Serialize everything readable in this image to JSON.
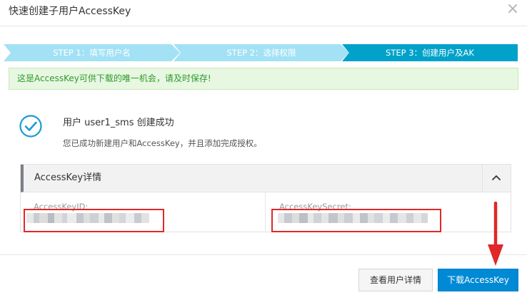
{
  "dialog": {
    "title": "快速创建子用户AccessKey",
    "close_glyph": "×"
  },
  "steps": [
    {
      "label": "STEP 1：填写用户名",
      "state": "done"
    },
    {
      "label": "STEP 2：选择权限",
      "state": "done"
    },
    {
      "label": "STEP 3：创建用户及AK",
      "state": "active"
    }
  ],
  "alert": {
    "text": "这是AccessKey可供下载的唯一机会，请及时保存!"
  },
  "result": {
    "icon": "check-circle-icon",
    "title": "用户 user1_sms 创建成功",
    "description": "您已成功新建用户和AccessKey，并且添加完成授权。"
  },
  "details": {
    "title": "AccessKey详情",
    "toggle_icon": "chevron-up-icon",
    "fields": [
      {
        "label": "AccessKeyID:"
      },
      {
        "label": "AccessKeySecret:"
      }
    ]
  },
  "footer": {
    "detail_button": "查看用户详情",
    "download_button": "下载AccessKey"
  },
  "colors": {
    "step_done": "#a3e1f5",
    "step_active": "#00a2ca",
    "alert_bg": "#e8f7e1",
    "alert_text": "#2d9a2d",
    "success_icon": "#1a9bd6",
    "primary_button": "#0089d4",
    "annotation_red": "#e02828"
  }
}
